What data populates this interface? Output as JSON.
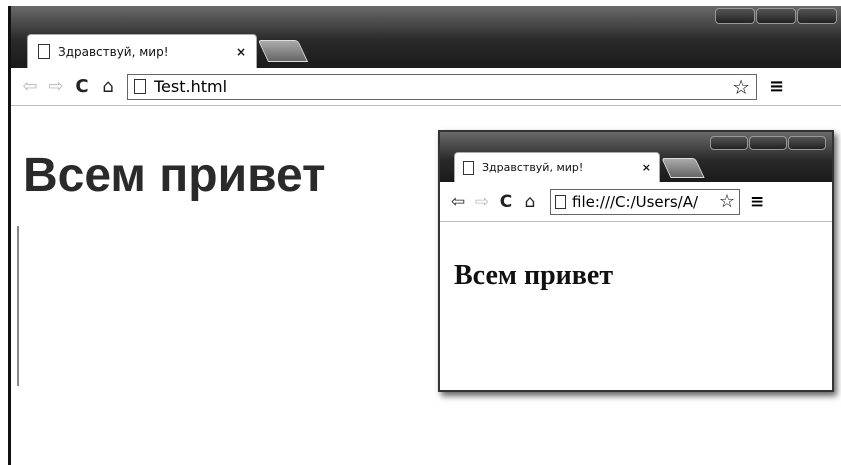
{
  "main_window": {
    "tab_title": "Здравствуй, мир!",
    "tab_close": "×",
    "address": "Test.html",
    "heading": "Всем привет",
    "icons": [
      "page-icon",
      "back-arrow-icon",
      "forward-arrow-icon",
      "reload-icon",
      "home-icon",
      "bookmark-star-icon",
      "menu-icon"
    ]
  },
  "inner_window": {
    "tab_title": "Здравствуй, мир!",
    "tab_close": "×",
    "address": "file:///C:/Users/A/",
    "heading": "Всем привет"
  }
}
